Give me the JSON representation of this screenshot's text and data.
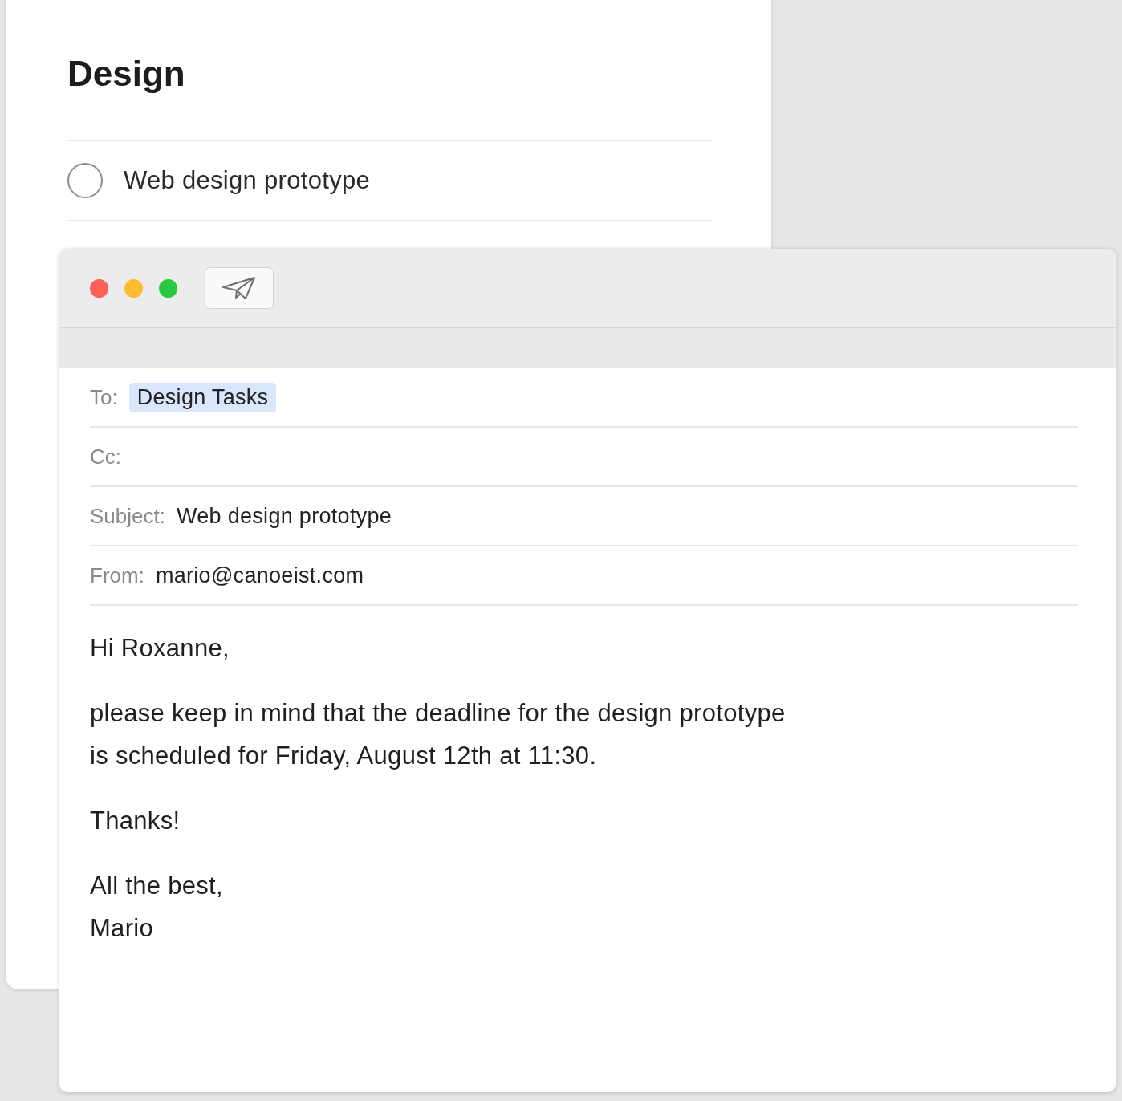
{
  "project": {
    "title": "Design",
    "tasks": [
      {
        "label": "Web design prototype",
        "checked": false
      }
    ]
  },
  "mail_window": {
    "traffic_lights": [
      {
        "color": "#fe5f57"
      },
      {
        "color": "#febc2e"
      },
      {
        "color": "#28c840"
      }
    ],
    "fields": [
      {
        "kind": "token",
        "label": "To:",
        "value": "Design Tasks"
      },
      {
        "kind": "text",
        "label": "Cc:"
      },
      {
        "kind": "text",
        "label": "Subject:",
        "value": "Web design prototype"
      },
      {
        "kind": "text",
        "label": "From:",
        "value": "mario@canoeist.com"
      }
    ],
    "body": [
      [
        "Hi Roxanne,"
      ],
      [
        "please keep in mind that the deadline for the design prototype",
        "is scheduled for Friday, August 12th at 11:30."
      ],
      [
        "Thanks!"
      ],
      [
        "All the best,",
        "Mario"
      ]
    ]
  }
}
